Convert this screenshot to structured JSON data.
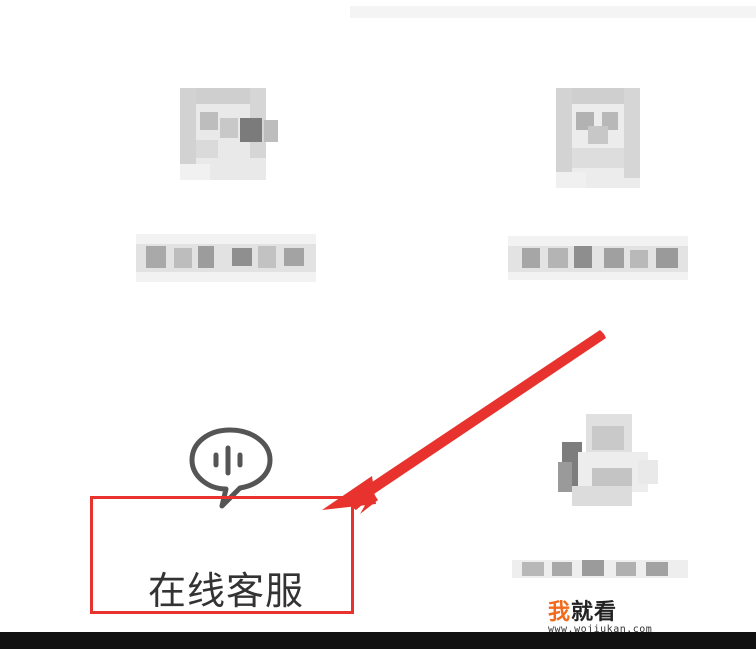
{
  "items": [
    {
      "label": ""
    },
    {
      "label": ""
    },
    {
      "label": "在线客服"
    },
    {
      "label": ""
    }
  ],
  "watermark": {
    "brand_first": "我",
    "brand_rest": "就看",
    "url": "www.wojiukan.com"
  },
  "colors": {
    "highlight": "#e8322e",
    "icon": "#555555",
    "text": "#333333"
  },
  "icons": {
    "customer_service": "chat-bubble-voice-icon"
  }
}
